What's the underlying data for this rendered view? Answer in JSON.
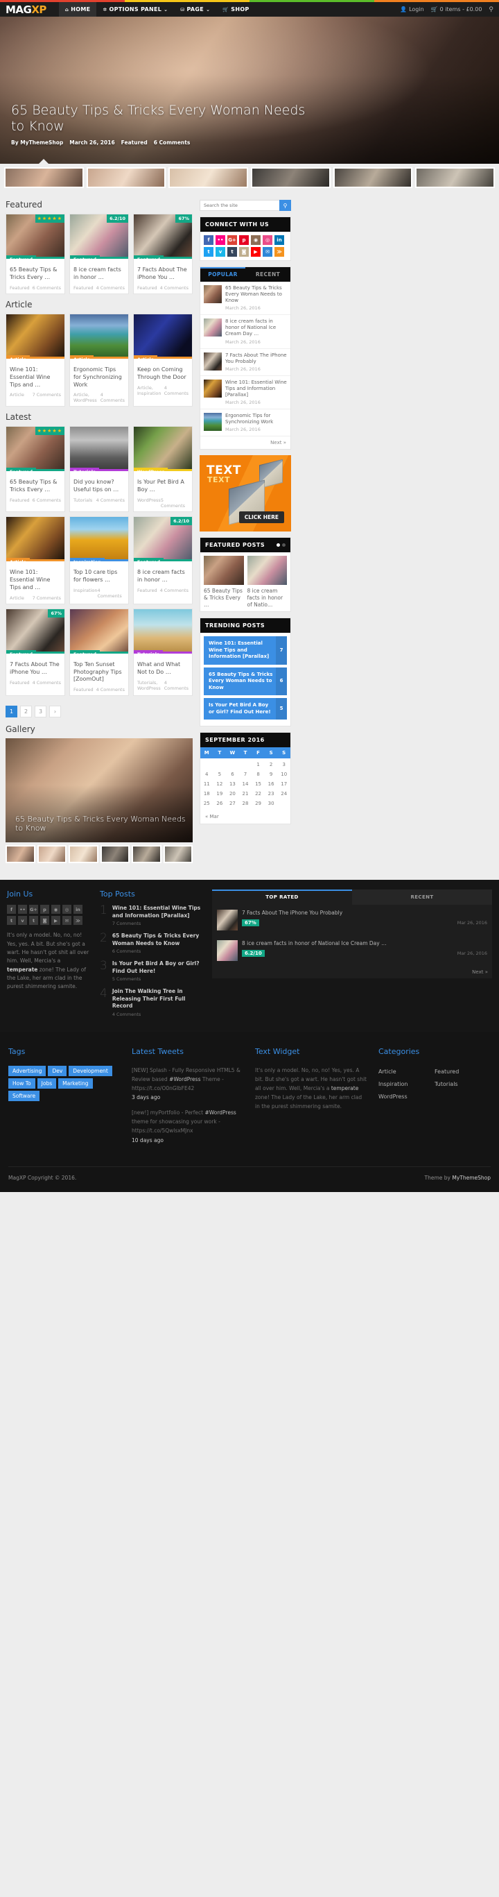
{
  "header": {
    "brand_main": "MAG",
    "brand_accent": "XP",
    "nav": [
      {
        "label": "HOME",
        "icon": "home-icon",
        "active": true,
        "caret": false
      },
      {
        "label": "OPTIONS PANEL",
        "icon": "gear-icon",
        "active": false,
        "caret": true
      },
      {
        "label": "PAGE",
        "icon": "sitemap-icon",
        "active": false,
        "caret": true
      },
      {
        "label": "SHOP",
        "icon": "cart-icon",
        "active": false,
        "caret": false
      }
    ],
    "login": "Login",
    "cart": "0 items - £0.00",
    "search_icon": "search-icon"
  },
  "hero": {
    "title": "65 Beauty Tips & Tricks Every Woman Needs to Know",
    "author": "By MyThemeShop",
    "date": "March 26, 2016",
    "category": "Featured",
    "comments": "6 Comments"
  },
  "sections": {
    "featured_title": "Featured",
    "article_title": "Article",
    "latest_title": "Latest",
    "gallery_title": "Gallery"
  },
  "featured": [
    {
      "title": "65 Beauty Tips & Tricks Every …",
      "tag": "Featured",
      "tag_class": "c-featured",
      "img": "im-beauty",
      "cat": "Featured",
      "comments": "6 Comments",
      "rating": "★★★★★",
      "rating_type": "stars"
    },
    {
      "title": "8 ice cream facts in honor …",
      "tag": "Featured",
      "tag_class": "c-featured",
      "img": "im-ice",
      "cat": "Featured",
      "comments": "4 Comments",
      "rating": "6.2/10",
      "rating_type": "badge"
    },
    {
      "title": "7 Facts About The iPhone You …",
      "tag": "Featured",
      "tag_class": "c-featured",
      "img": "im-phone",
      "cat": "Featured",
      "comments": "4 Comments",
      "rating": "67%",
      "rating_type": "badge"
    }
  ],
  "article": [
    {
      "title": "Wine 101: Essential Wine Tips and …",
      "tag": "Article",
      "tag_class": "c-article",
      "img": "im-wine",
      "cat": "Article",
      "comments": "7 Comments",
      "rating": "",
      "rating_type": "none"
    },
    {
      "title": "Ergonomic Tips for Synchronizing Work",
      "tag": "Article",
      "tag_class": "c-article",
      "img": "im-chairs",
      "cat": "Article, WordPress",
      "comments": "4 Comments",
      "rating": "",
      "rating_type": "none"
    },
    {
      "title": "Keep on Coming Through the Door",
      "tag": "Article",
      "tag_class": "c-article",
      "img": "im-dj",
      "cat": "Article, Inspiration",
      "comments": "4 Comments",
      "rating": "",
      "rating_type": "none"
    }
  ],
  "latest": [
    {
      "title": "65 Beauty Tips & Tricks Every …",
      "tag": "Featured",
      "tag_class": "c-featured",
      "img": "im-beauty",
      "cat": "Featured",
      "comments": "6 Comments",
      "rating": "★★★★★",
      "rating_type": "stars"
    },
    {
      "title": "Did you know? Useful tips on …",
      "tag": "Tutorials",
      "tag_class": "c-tutorials",
      "img": "im-street",
      "cat": "Tutorials",
      "comments": "4 Comments",
      "rating": "",
      "rating_type": "none"
    },
    {
      "title": "Is Your Pet Bird A Boy …",
      "tag": "WordPress",
      "tag_class": "c-wordpress",
      "img": "im-bird",
      "cat": "WordPress",
      "comments": "5 Comments",
      "rating": "",
      "rating_type": "none"
    },
    {
      "title": "Wine 101: Essential Wine Tips and …",
      "tag": "Article",
      "tag_class": "c-article",
      "img": "im-wine",
      "cat": "Article",
      "comments": "7 Comments",
      "rating": "",
      "rating_type": "none"
    },
    {
      "title": "Top 10 care tips for flowers …",
      "tag": "Inspiration",
      "tag_class": "c-inspiration",
      "img": "im-flower",
      "cat": "Inspiration",
      "comments": "4 Comments",
      "rating": "",
      "rating_type": "none"
    },
    {
      "title": "8 ice cream facts in honor …",
      "tag": "Featured",
      "tag_class": "c-featured",
      "img": "im-ice",
      "cat": "Featured",
      "comments": "4 Comments",
      "rating": "6.2/10",
      "rating_type": "badge"
    },
    {
      "title": "7 Facts About The iPhone You …",
      "tag": "Featured",
      "tag_class": "c-featured",
      "img": "im-phone",
      "cat": "Featured",
      "comments": "4 Comments",
      "rating": "67%",
      "rating_type": "badge"
    },
    {
      "title": "Top Ten Sunset Photography Tips [ZoomOut]",
      "tag": "Featured",
      "tag_class": "c-featured",
      "img": "im-sunset",
      "cat": "Featured",
      "comments": "4 Comments",
      "rating": "",
      "rating_type": "none"
    },
    {
      "title": "What and What Not to Do …",
      "tag": "Tutorials",
      "tag_class": "c-tutorials",
      "img": "im-wheat",
      "cat": "Tutorials, WordPress",
      "comments": "4 Comments",
      "rating": "",
      "rating_type": "none"
    }
  ],
  "pagination": {
    "pages": [
      "1",
      "2",
      "3"
    ],
    "next": "›",
    "current": "1"
  },
  "gallery": {
    "caption": "65 Beauty Tips & Tricks Every Woman Needs to Know"
  },
  "search": {
    "placeholder": "Search the site",
    "icon": "search-icon"
  },
  "connect": {
    "title": "CONNECT WITH US",
    "icons": [
      {
        "name": "facebook-icon",
        "glyph": "f",
        "color": "#4267b2"
      },
      {
        "name": "flickr-icon",
        "glyph": "••",
        "color": "#ff0084"
      },
      {
        "name": "google-plus-icon",
        "glyph": "G+",
        "color": "#db4437"
      },
      {
        "name": "pinterest-icon",
        "glyph": "p",
        "color": "#e60023"
      },
      {
        "name": "instagram-icon",
        "glyph": "◉",
        "color": "#8d6e55"
      },
      {
        "name": "dribbble-icon",
        "glyph": "◎",
        "color": "#ea4c89"
      },
      {
        "name": "linkedin-icon",
        "glyph": "in",
        "color": "#0077b5"
      },
      {
        "name": "twitter-icon",
        "glyph": "t",
        "color": "#1da1f2"
      },
      {
        "name": "vimeo-icon",
        "glyph": "v",
        "color": "#1ab7ea"
      },
      {
        "name": "tumblr-icon",
        "glyph": "t",
        "color": "#35465c"
      },
      {
        "name": "github-icon",
        "glyph": "◙",
        "color": "#bfae8e"
      },
      {
        "name": "youtube-icon",
        "glyph": "▶",
        "color": "#ff0000"
      },
      {
        "name": "email-icon",
        "glyph": "✉",
        "color": "#2e87d8"
      },
      {
        "name": "rss-icon",
        "glyph": "≫",
        "color": "#f5931e"
      }
    ]
  },
  "posts_tabs": {
    "popular": "POPULAR",
    "recent": "RECENT",
    "active": "POPULAR",
    "next": "Next »"
  },
  "popular_posts": [
    {
      "title": "65 Beauty Tips & Tricks Every Woman Needs to Know",
      "date": "March 26, 2016",
      "img": "im-beauty"
    },
    {
      "title": "8 ice cream facts in honor of National Ice Cream Day …",
      "date": "March 26, 2016",
      "img": "im-ice"
    },
    {
      "title": "7 Facts About The iPhone You Probably",
      "date": "March 26, 2016",
      "img": "im-phone"
    },
    {
      "title": "Wine 101: Essential Wine Tips and Information [Parallax]",
      "date": "March 26, 2016",
      "img": "im-wine"
    },
    {
      "title": "Ergonomic Tips for Synchronizing Work",
      "date": "March 26, 2016",
      "img": "im-chairs"
    }
  ],
  "ad": {
    "line1": "TEXT",
    "line2": "TEXT",
    "cta": "CLICK HERE"
  },
  "featured_posts": {
    "title": "FEATURED POSTS",
    "items": [
      {
        "title": "65 Beauty Tips & Tricks Every …",
        "img": "im-beauty"
      },
      {
        "title": "8 ice cream facts in honor of Natio…",
        "img": "im-ice"
      }
    ]
  },
  "trending": {
    "title": "TRENDING POSTS",
    "items": [
      {
        "title": "Wine 101: Essential Wine Tips and Information [Parallax]",
        "count": "7"
      },
      {
        "title": "65 Beauty Tips & Tricks Every Woman Needs to Know",
        "count": "6"
      },
      {
        "title": "Is Your Pet Bird A Boy or Girl? Find Out Here!",
        "count": "5"
      }
    ]
  },
  "calendar": {
    "title": "SEPTEMBER 2016",
    "days": [
      "M",
      "T",
      "W",
      "T",
      "F",
      "S",
      "S"
    ],
    "blanks": 4,
    "dates": [
      1,
      2,
      3,
      4,
      5,
      6,
      7,
      8,
      9,
      10,
      11,
      12,
      13,
      14,
      15,
      16,
      17,
      18,
      19,
      20,
      21,
      22,
      23,
      24,
      25,
      26,
      27,
      28,
      29,
      30
    ],
    "prev": "« Mar"
  },
  "join_us": {
    "title": "Join Us",
    "icons": [
      "f",
      "••",
      "G+",
      "p",
      "◉",
      "◎",
      "in",
      "t",
      "v",
      "t",
      "◙",
      "▶",
      "✉",
      "≫"
    ],
    "text_before": "It's only a model. No, no, no! Yes, yes. A bit. But she's got a wart. He hasn't got shit all over him. Well, Mercia's a ",
    "text_bold": "temperate",
    "text_after": " zone! The Lady of the Lake, her arm clad in the purest shimmering samite."
  },
  "top_posts": {
    "title": "Top Posts",
    "items": [
      {
        "n": "1",
        "title": "Wine 101: Essential Wine Tips and Information [Parallax]",
        "comments": "7 Comments"
      },
      {
        "n": "2",
        "title": "65 Beauty Tips & Tricks Every Woman Needs to Know",
        "comments": "6 Comments"
      },
      {
        "n": "3",
        "title": "Is Your Pet Bird A Boy or Girl? Find Out Here!",
        "comments": "5 Comments"
      },
      {
        "n": "4",
        "title": "Join The Walking Tree in Releasing Their First Full Record",
        "comments": "4 Comments"
      }
    ]
  },
  "top_rated": {
    "tab_rated": "TOP RATED",
    "tab_recent": "RECENT",
    "active": "TOP RATED",
    "next": "Next »",
    "items": [
      {
        "title": "7 Facts About The iPhone You Probably",
        "score": "67%",
        "date": "Mar 26, 2016",
        "img": "im-phone"
      },
      {
        "title": "8 ice cream facts in honor of National Ice Cream Day …",
        "score": "6.2/10",
        "date": "Mar 26, 2016",
        "img": "im-ice"
      }
    ]
  },
  "footer": {
    "tags_title": "Tags",
    "tags": [
      "Advertising",
      "Dev",
      "Development",
      "How To",
      "Jobs",
      "Marketing",
      "Software"
    ],
    "tweets_title": "Latest Tweets",
    "tweets": [
      {
        "pre": "[NEW] Splash - Fully Responsive HTML5 & Review based ",
        "tag": "#WordPress",
        "post": " Theme - https://t.co/O0nGIbFE42",
        "ago": "3 days ago"
      },
      {
        "pre": "[new!] myPortfolio - Perfect ",
        "tag": "#WordPress",
        "post": " theme for showcasing your work - https://t.co/5QwlsxMJnx",
        "ago": "10 days ago"
      }
    ],
    "text_title": "Text Widget",
    "text_before": "It's only a model. No, no, no! Yes, yes. A bit. But she's got a wart. He hasn't got shit all over him. Well, Mercia's a ",
    "text_bold": "temperate",
    "text_after": " zone! The Lady of the Lake, her arm clad in the purest shimmering samite.",
    "cats_title": "Categories",
    "cats": [
      "Article",
      "Featured",
      "Inspiration",
      "Tutorials",
      "WordPress"
    ],
    "copyright": "MagXP Copyright © 2016.",
    "theme_by": "Theme by ",
    "theme_name": "MyThemeShop"
  }
}
